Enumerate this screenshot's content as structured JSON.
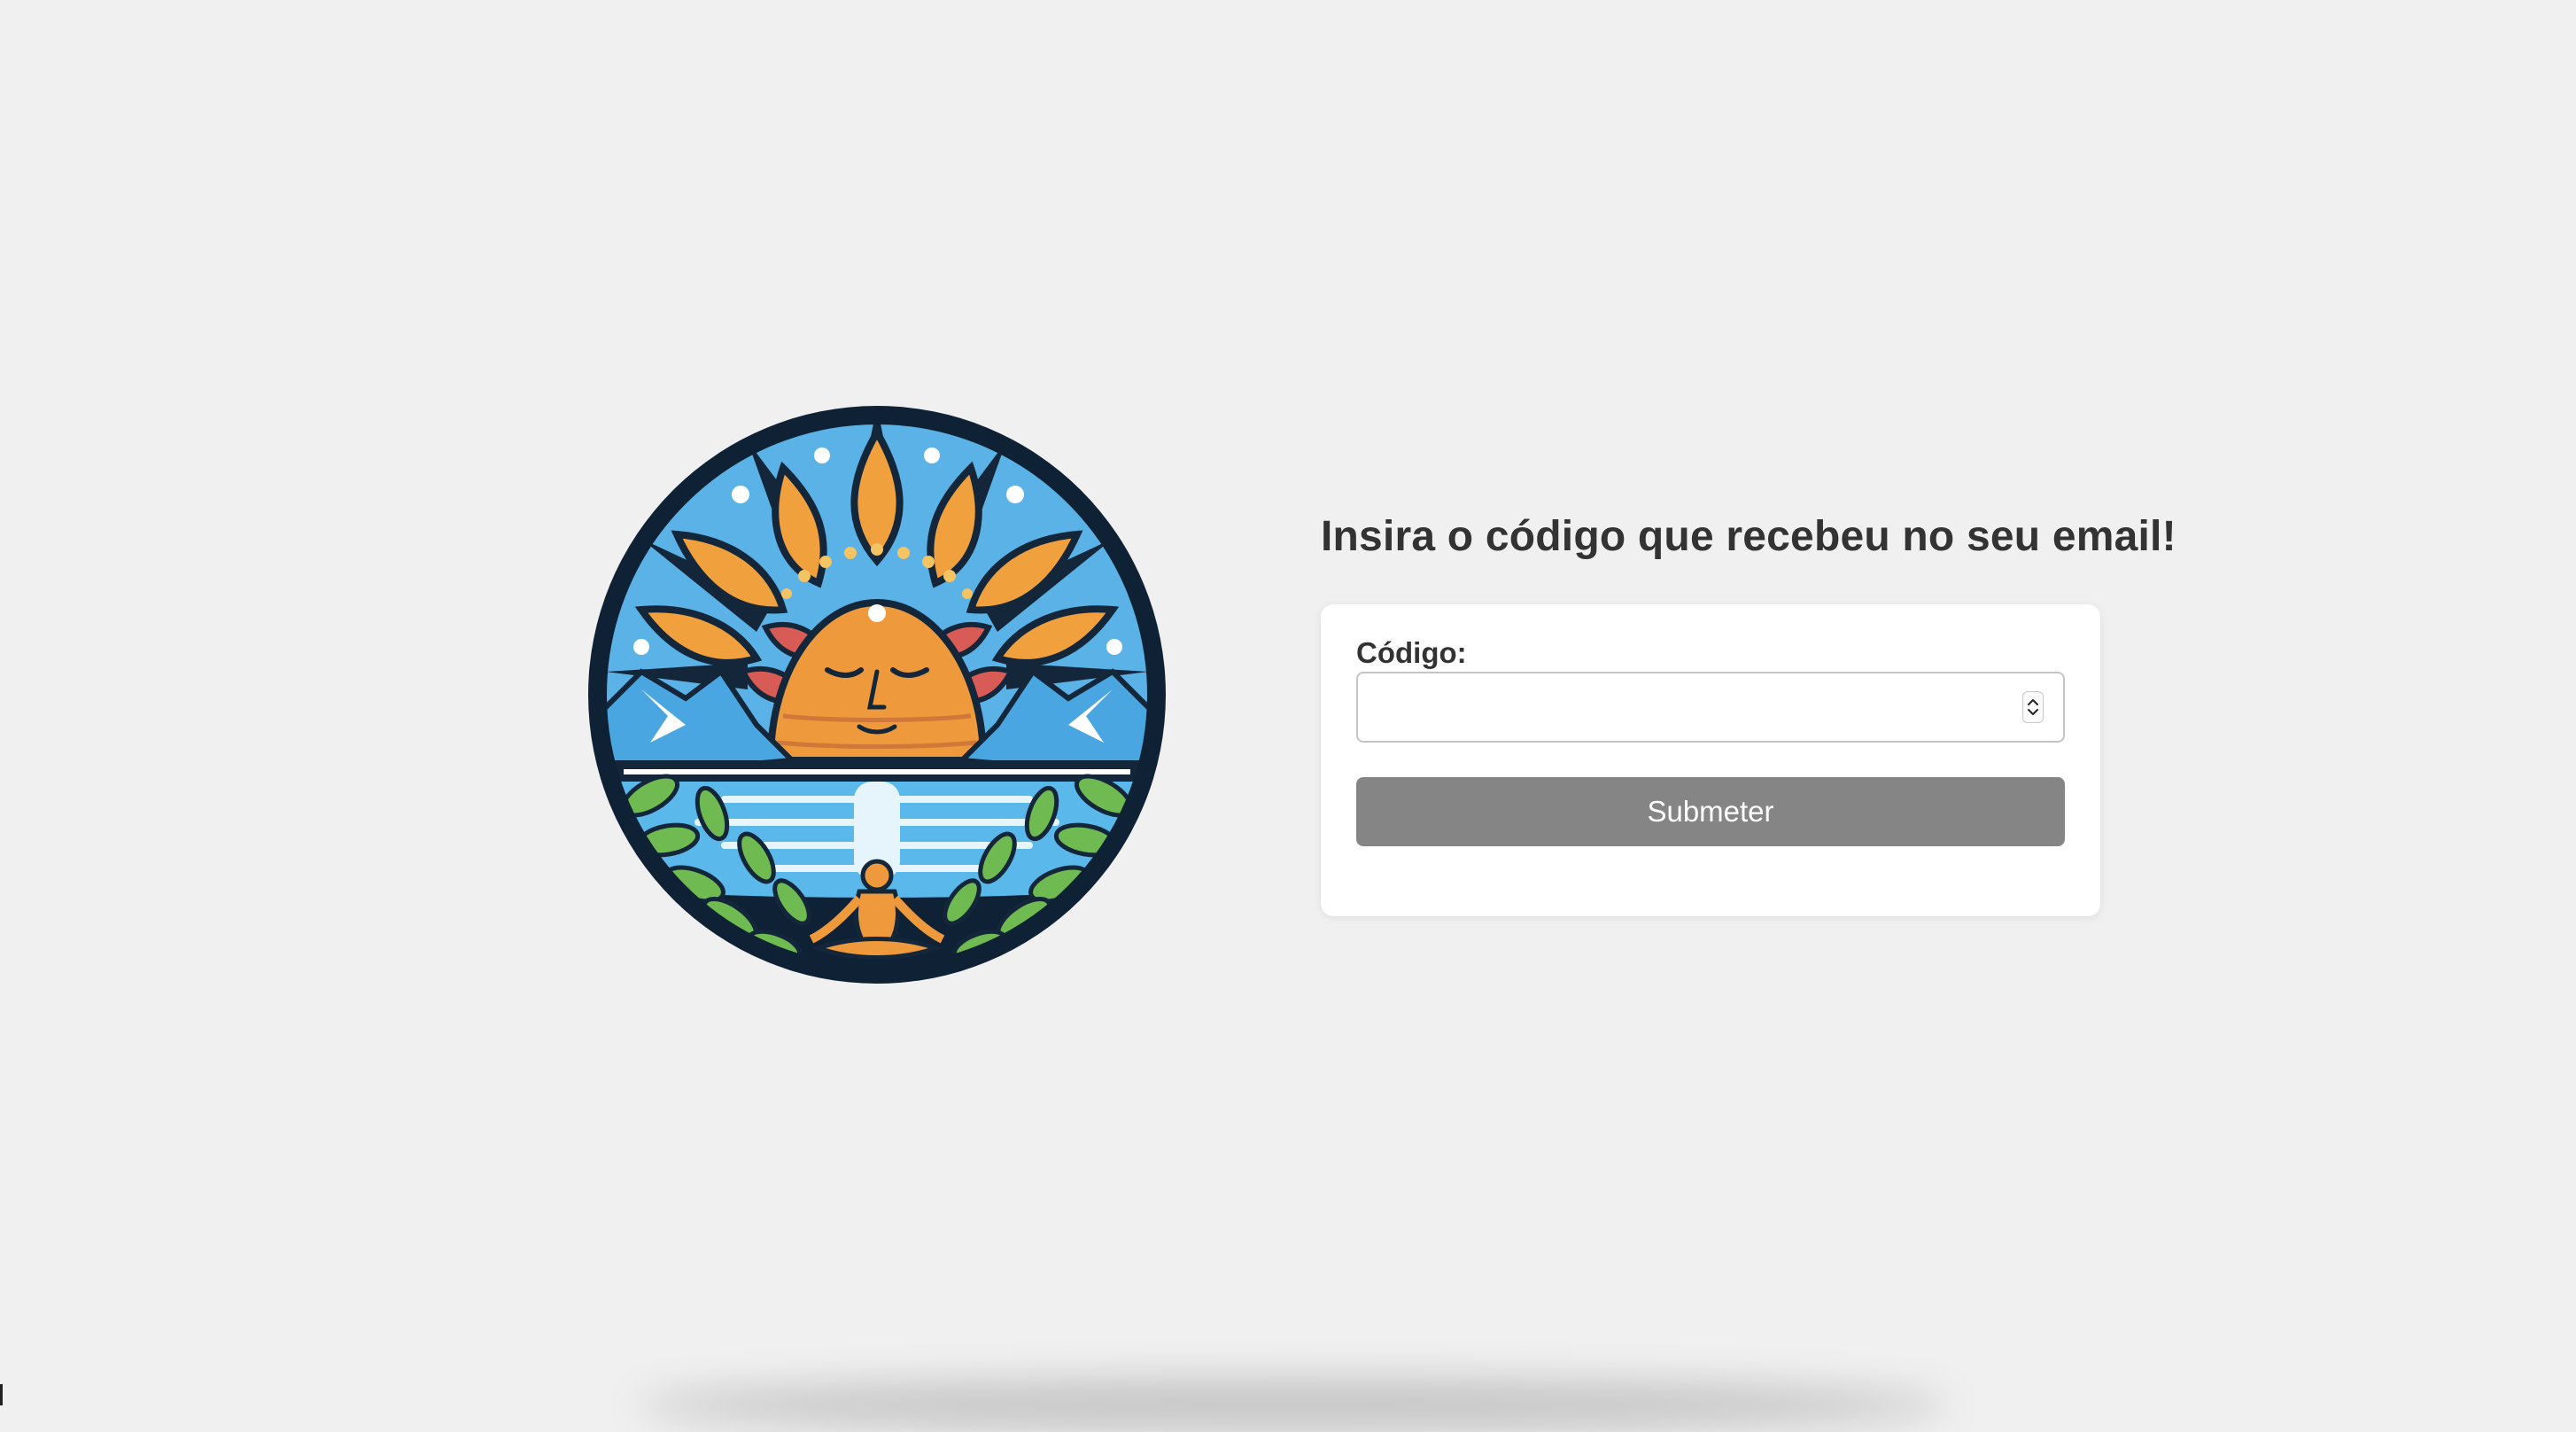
{
  "form": {
    "heading": "Insira o código que recebeu no seu email!",
    "code_label": "Código:",
    "code_value": "",
    "submit_label": "Submeter"
  },
  "icons": {
    "logo": "sun-meditation-logo",
    "spinner": "number-spinner-icon"
  },
  "colors": {
    "background": "#f0f0f0",
    "card": "#ffffff",
    "button": "#858585",
    "heading_text": "#333333"
  }
}
